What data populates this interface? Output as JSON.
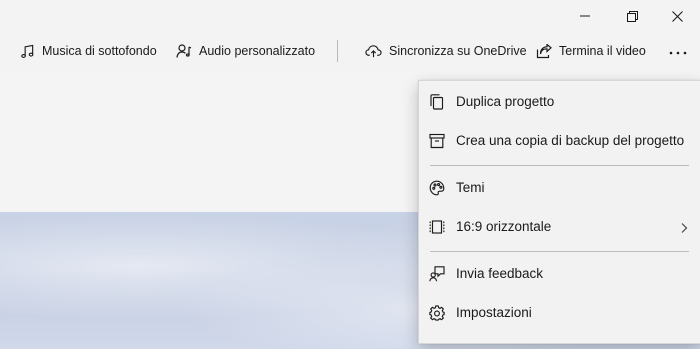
{
  "window_controls": {
    "minimize_icon": "minimize-icon",
    "restore_icon": "restore-icon",
    "close_icon": "close-icon"
  },
  "toolbar": {
    "items": [
      {
        "label": "Musica di sottofondo",
        "icon": "music-note-icon"
      },
      {
        "label": "Audio personalizzato",
        "icon": "person-audio-icon"
      },
      {
        "label": "Sincronizza su OneDrive",
        "icon": "cloud-upload-icon"
      },
      {
        "label": "Termina il video",
        "icon": "share-icon"
      }
    ],
    "more_icon": "more-icon"
  },
  "menu": {
    "items": [
      {
        "label": "Duplica progetto",
        "icon": "copy-icon"
      },
      {
        "label": "Crea una copia di backup del progetto",
        "icon": "archive-icon"
      },
      {
        "label": "Temi",
        "icon": "palette-icon"
      },
      {
        "label": "16:9 orizzontale",
        "icon": "aspect-ratio-icon",
        "has_submenu": true
      },
      {
        "label": "Invia feedback",
        "icon": "feedback-icon"
      },
      {
        "label": "Impostazioni",
        "icon": "gear-icon"
      }
    ]
  },
  "colors": {
    "background": "#f3f3f3",
    "menu_background": "#f2f2f2",
    "text": "#1a1a1a",
    "preview_tint": "#c9d3e6"
  }
}
